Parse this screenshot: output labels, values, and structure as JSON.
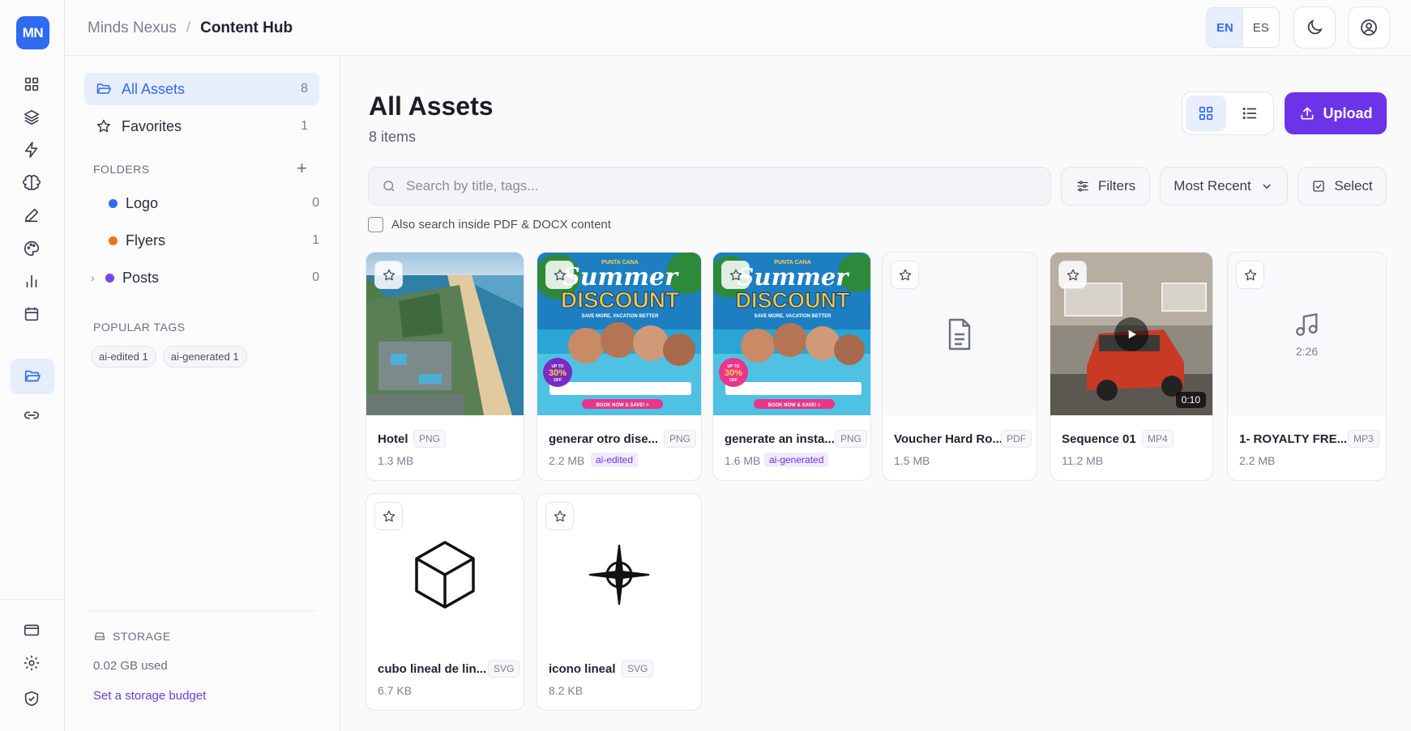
{
  "brand": {
    "logo_text": "MN",
    "accent": "#2f6bf0",
    "primary": "#6d33e8"
  },
  "rail": {
    "items": [
      "grid-icon",
      "layers-icon",
      "bolt-icon",
      "brain-icon",
      "pen-icon",
      "palette-icon",
      "bar-chart-icon",
      "calendar-icon",
      "folder-open-icon",
      "link-icon"
    ],
    "bottom": [
      "credit-card-icon",
      "gear-icon",
      "shield-check-icon"
    ]
  },
  "breadcrumb": {
    "root": "Minds Nexus",
    "separator": "/",
    "current": "Content Hub"
  },
  "topbar": {
    "lang_en": "EN",
    "lang_es": "ES"
  },
  "sidebar": {
    "all_assets": {
      "label": "All Assets",
      "count": "8"
    },
    "favorites": {
      "label": "Favorites",
      "count": "1"
    },
    "folders_title": "FOLDERS",
    "folders": [
      {
        "name": "Logo",
        "count": "0",
        "color": "#2f6bf0"
      },
      {
        "name": "Flyers",
        "count": "1",
        "color": "#e8731c"
      },
      {
        "name": "Posts",
        "count": "0",
        "color": "#7a45e3"
      }
    ],
    "tags_title": "POPULAR TAGS",
    "tags": [
      "ai-edited 1",
      "ai-generated 1"
    ],
    "storage_title": "STORAGE",
    "storage_used": "0.02 GB used",
    "storage_link": "Set a storage budget"
  },
  "main": {
    "title": "All Assets",
    "subtitle": "8 items",
    "upload_label": "Upload",
    "search_placeholder": "Search by title, tags...",
    "filters_label": "Filters",
    "sort_label": "Most Recent",
    "select_label": "Select",
    "pdf_search_label": "Also search inside PDF & DOCX content"
  },
  "assets": [
    {
      "name": "Hotel",
      "type": "PNG",
      "size": "1.3 MB",
      "tag": ""
    },
    {
      "name": "generar otro dise...",
      "type": "PNG",
      "size": "2.2 MB",
      "tag": "ai-edited"
    },
    {
      "name": "generate an insta...",
      "type": "PNG",
      "size": "1.6 MB",
      "tag": "ai-generated"
    },
    {
      "name": "Voucher Hard Ro...",
      "type": "PDF",
      "size": "1.5 MB",
      "tag": ""
    },
    {
      "name": "Sequence 01",
      "type": "MP4",
      "size": "11.2 MB",
      "tag": "",
      "duration": "0:10"
    },
    {
      "name": "1- ROYALTY FRE...",
      "type": "MP3",
      "size": "2.2 MB",
      "tag": "",
      "duration": "2:26"
    },
    {
      "name": "cubo lineal de lin...",
      "type": "SVG",
      "size": "6.7 KB",
      "tag": ""
    },
    {
      "name": "icono lineal",
      "type": "SVG",
      "size": "8.2 KB",
      "tag": ""
    }
  ],
  "flyer_text": {
    "brand": "PUNTA CANA",
    "line1": "Summer",
    "line2": "DISCOUNT",
    "tagline": "SAVE MORE, VACATION BETTER",
    "badge_top": "UP TO",
    "badge_pct": "30%",
    "badge_off": "OFF",
    "cta": "BOOK NOW & SAVE! >"
  }
}
